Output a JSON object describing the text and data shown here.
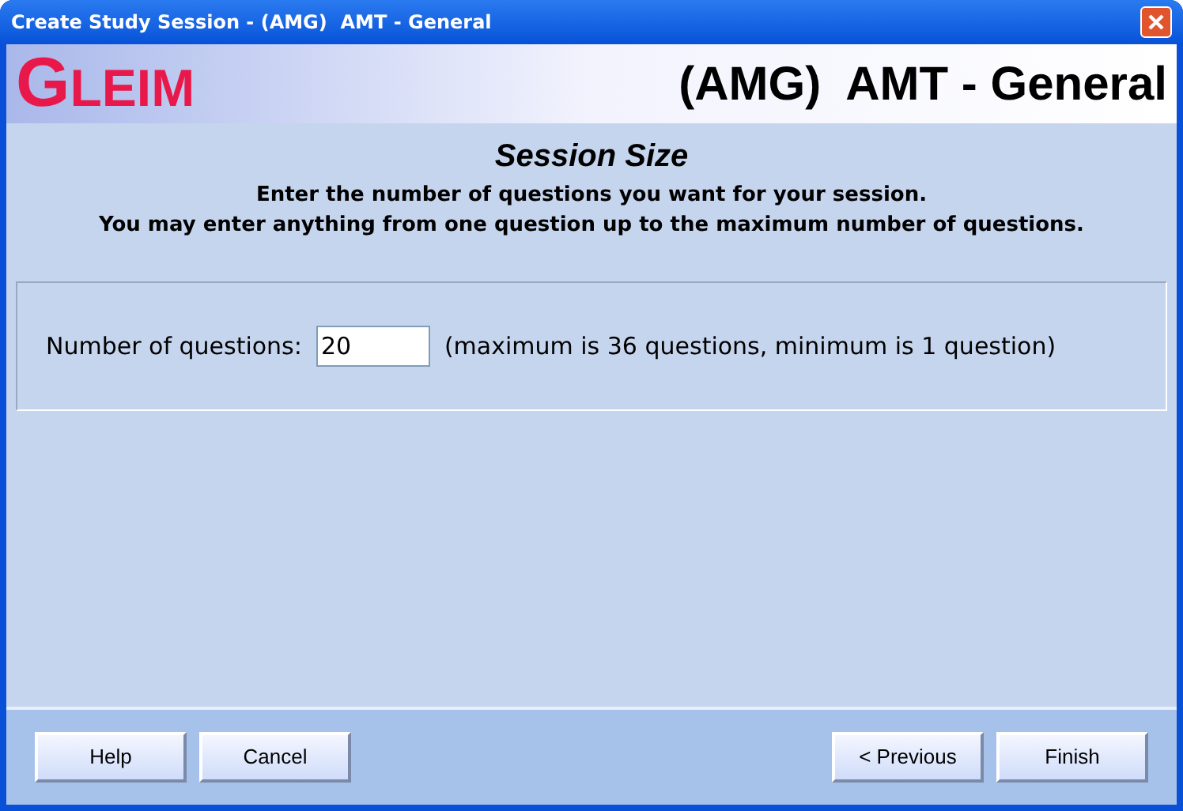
{
  "window": {
    "title": "Create Study Session - (AMG)  AMT - General"
  },
  "header": {
    "logo": "GLEIM",
    "course": "(AMG)  AMT - General"
  },
  "section": {
    "title": "Session Size",
    "instructions": [
      "Enter the number of questions you want for your session.",
      "You may enter anything from one question up to the maximum number of questions."
    ]
  },
  "form": {
    "label": "Number of questions:",
    "value": "20",
    "hint": "(maximum is 36 questions, minimum is 1 question)"
  },
  "buttons_left": [
    "Help",
    "Cancel"
  ],
  "buttons_right": [
    "< Previous",
    "Finish"
  ]
}
